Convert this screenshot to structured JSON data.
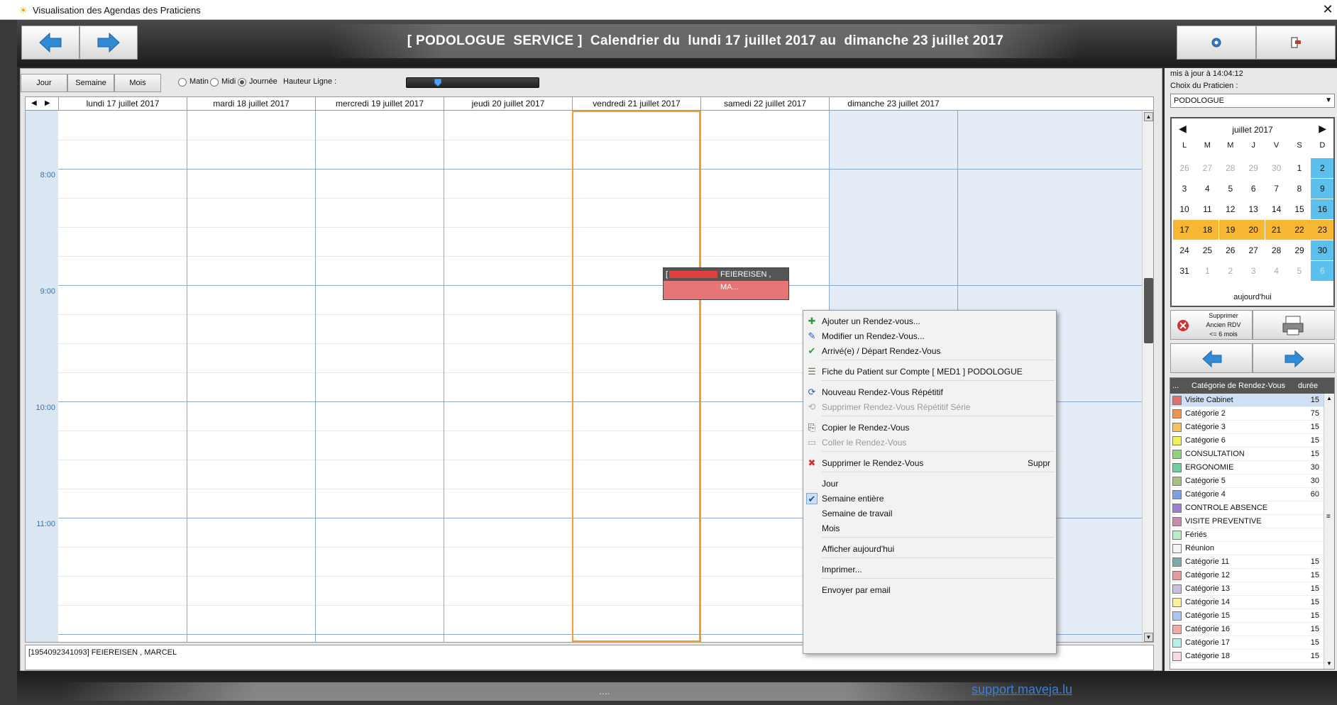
{
  "window": {
    "title": "Visualisation des Agendas des Praticiens"
  },
  "header": {
    "banner": "[ PODOLOGUE  SERVICE ]  Calendrier du  lundi 17 juillet 2017 au  dimanche 23 juillet 2017"
  },
  "toolbar": {
    "views": [
      "Jour",
      "Semaine",
      "Mois"
    ],
    "radios": [
      {
        "label": "Matin",
        "checked": false
      },
      {
        "label": "Midi",
        "checked": false
      },
      {
        "label": "Journée",
        "checked": true
      }
    ],
    "hauteur_label": "Hauteur Ligne :",
    "hauteur_level": 0.22
  },
  "days": [
    "lundi 17 juillet 2017",
    "mardi 18 juillet 2017",
    "mercredi 19 juillet 2017",
    "jeudi 20 juillet 2017",
    "vendredi 21 juillet 2017",
    "samedi 22 juillet 2017",
    "dimanche 23 juillet 2017"
  ],
  "times": [
    "8:00",
    "9:00",
    "10:00",
    "11:00"
  ],
  "appointment": {
    "name": "FEIEREISEN , MA...",
    "redacted_prefix": "["
  },
  "info_text": "[1954092341093]  FEIEREISEN , MARCEL",
  "context_menu": [
    {
      "label": "Ajouter un Rendez-vous...",
      "icon": "add-icon",
      "disabled": false
    },
    {
      "label": "Modifier un Rendez-Vous...",
      "icon": "edit-icon",
      "disabled": false
    },
    {
      "label": "Arrivé(e) / Départ Rendez-Vous",
      "icon": "check-icon",
      "disabled": false
    },
    {
      "sep": true
    },
    {
      "label": "Fiche du Patient  sur Compte [ MED1 ] PODOLOGUE",
      "icon": "patient-icon",
      "disabled": false
    },
    {
      "sep": true
    },
    {
      "label": "Nouveau Rendez-Vous Répétitif",
      "icon": "repeat-icon",
      "disabled": false
    },
    {
      "label": "Supprimer Rendez-Vous Répétitif Série",
      "icon": "repeat-delete-icon",
      "disabled": true
    },
    {
      "sep": true
    },
    {
      "label": "Copier le Rendez-Vous",
      "icon": "copy-icon",
      "disabled": false
    },
    {
      "label": "Coller le Rendez-Vous",
      "icon": "paste-icon",
      "disabled": true
    },
    {
      "sep": true
    },
    {
      "label": "Supprimer le Rendez-Vous",
      "icon": "delete-icon",
      "disabled": false,
      "shortcut": "Suppr"
    },
    {
      "sep": true
    },
    {
      "label": "Jour",
      "disabled": false
    },
    {
      "label": "Semaine entière",
      "icon": "checkmark-icon",
      "disabled": false,
      "checked": true
    },
    {
      "label": "Semaine de travail",
      "disabled": false
    },
    {
      "label": "Mois",
      "disabled": false
    },
    {
      "sep": true
    },
    {
      "label": "Afficher aujourd'hui",
      "disabled": false
    },
    {
      "sep": true
    },
    {
      "label": "Imprimer...",
      "disabled": false
    },
    {
      "sep": true
    },
    {
      "label": "Envoyer par email",
      "disabled": false
    }
  ],
  "right_panel": {
    "updated": "mis à jour à 14:04:12",
    "praticien_label": "Choix du Praticien :",
    "praticien_value": "PODOLOGUE",
    "calendar": {
      "month": "juillet 2017",
      "weekdays": [
        "L",
        "M",
        "M",
        "J",
        "V",
        "S",
        "D"
      ],
      "weeks": [
        [
          "26",
          "27",
          "28",
          "29",
          "30",
          "1",
          "2"
        ],
        [
          "3",
          "4",
          "5",
          "6",
          "7",
          "8",
          "9"
        ],
        [
          "10",
          "11",
          "12",
          "13",
          "14",
          "15",
          "16"
        ],
        [
          "17",
          "18",
          "19",
          "20",
          "21",
          "22",
          "23"
        ],
        [
          "24",
          "25",
          "26",
          "27",
          "28",
          "29",
          "30"
        ],
        [
          "31",
          "1",
          "2",
          "3",
          "4",
          "5",
          "6"
        ]
      ],
      "today_label": "aujourd'hui"
    },
    "delete_label_1": "Supprimer",
    "delete_label_2": "Ancien RDV",
    "delete_label_3": "<= 6 mois",
    "cat_header": {
      "dots": "...",
      "name": "Catégorie de Rendez-Vous",
      "dur": "durée"
    },
    "categories": [
      {
        "name": "Visite Cabinet",
        "dur": "15",
        "color": "#e56d6d",
        "selected": true
      },
      {
        "name": "Catégorie 2",
        "dur": "75",
        "color": "#f0964b"
      },
      {
        "name": "Catégorie 3",
        "dur": "15",
        "color": "#f7c35a"
      },
      {
        "name": "Catégorie 6",
        "dur": "15",
        "color": "#f2ef58"
      },
      {
        "name": "CONSULTATION",
        "dur": "15",
        "color": "#8ed27a"
      },
      {
        "name": "ERGONOMIE",
        "dur": "30",
        "color": "#6ecfa0"
      },
      {
        "name": "Catégorie 5",
        "dur": "30",
        "color": "#a6c17c"
      },
      {
        "name": "Catégorie 4",
        "dur": "60",
        "color": "#7f9fdf"
      },
      {
        "name": "CONTROLE ABSENCE",
        "dur": "",
        "color": "#9e7fd6"
      },
      {
        "name": "VISITE PREVENTIVE",
        "dur": "",
        "color": "#c98ab0"
      },
      {
        "name": "Fériés",
        "dur": "",
        "color": "#b7f0c7"
      },
      {
        "name": "Réunion",
        "dur": "",
        "color": "#f4f4f4"
      },
      {
        "name": "Catégorie 11",
        "dur": "15",
        "color": "#7fa9a9"
      },
      {
        "name": "Catégorie 12",
        "dur": "15",
        "color": "#e59999"
      },
      {
        "name": "Catégorie 13",
        "dur": "15",
        "color": "#c7c0e0"
      },
      {
        "name": "Catégorie 14",
        "dur": "15",
        "color": "#f8f0a0"
      },
      {
        "name": "Catégorie 15",
        "dur": "15",
        "color": "#a8c7f0"
      },
      {
        "name": "Catégorie 16",
        "dur": "15",
        "color": "#f3a8a8"
      },
      {
        "name": "Catégorie 17",
        "dur": "15",
        "color": "#b8f0e8"
      },
      {
        "name": "Catégorie 18",
        "dur": "15",
        "color": "#f8d8e8"
      }
    ]
  },
  "footer": {
    "dots": "....",
    "link": "support.maveja.lu"
  },
  "colors": {
    "week_highlight": "#f7b733",
    "weekend": "#5bc0eb",
    "grid_line": "#8fa7c8",
    "time_text": "#3470b8",
    "appointment": "#e67676"
  }
}
